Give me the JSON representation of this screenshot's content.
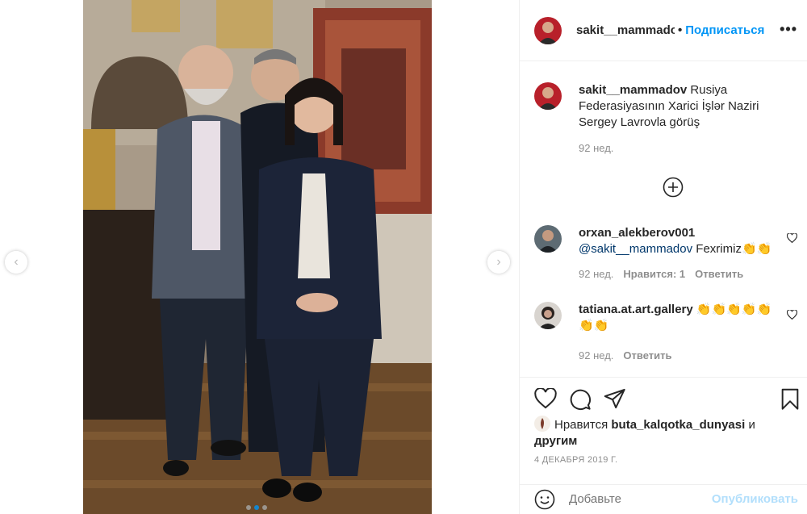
{
  "post": {
    "author": "sakit__mammadov",
    "header_separator": "•",
    "follow_label": "Подписаться",
    "more_label": "•••",
    "caption": {
      "username": "sakit__mammadov",
      "text": "Rusiya Federasiyasının Xarici İşlər Naziri Sergey Lavrovla görüş",
      "time": "92 нед."
    },
    "comments": [
      {
        "username": "orxan_alekberov001",
        "mention": "@sakit__mammadov",
        "text": "Fexrimiz👏👏",
        "time": "92 нед.",
        "likes": "Нравится: 1",
        "reply": "Ответить"
      },
      {
        "username": "tatiana.at.art.gallery",
        "text": "👏👏👏👏👏👏👏",
        "time": "92 нед.",
        "reply": "Ответить"
      }
    ],
    "liked_by": {
      "prefix": "Нравится",
      "user": "buta_kalqotka_dunyasi",
      "and": "и",
      "others": "другим"
    },
    "date": "4 ДЕКАБРЯ 2019 Г.",
    "add_comment_placeholder": "Добавьте",
    "publish_label": "Опубликовать"
  },
  "carousel": {
    "slide_count": 3,
    "active_index": 1
  },
  "icons": {
    "prev": "chevron-left-icon",
    "next": "chevron-right-icon",
    "like": "heart-icon",
    "comment": "comment-icon",
    "share": "paper-plane-icon",
    "save": "bookmark-icon",
    "emoji": "smiley-icon",
    "load_more": "plus-circle-icon"
  },
  "colors": {
    "accent": "#0095f6",
    "muted": "#8e8e8e",
    "publish_disabled": "#b2dffc"
  }
}
